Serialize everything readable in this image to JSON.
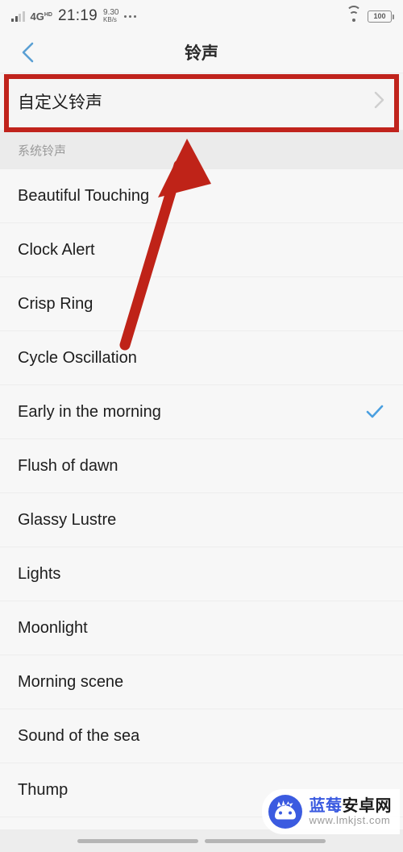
{
  "status_bar": {
    "network_type": "4G",
    "network_type_sup": "HD",
    "time": "21:19",
    "net_speed_value": "9.30",
    "net_speed_unit": "KB/s",
    "more_icon": "three-dots-icon",
    "wifi_icon": "wifi-icon",
    "battery_level": "100"
  },
  "titlebar": {
    "back_icon": "chevron-left-icon",
    "title": "铃声"
  },
  "custom_ringtone": {
    "label": "自定义铃声",
    "chevron_icon": "chevron-right-icon"
  },
  "section": {
    "header": "系统铃声"
  },
  "ringtones": [
    {
      "name": "Beautiful Touching",
      "selected": false
    },
    {
      "name": "Clock Alert",
      "selected": false
    },
    {
      "name": "Crisp Ring",
      "selected": false
    },
    {
      "name": "Cycle Oscillation",
      "selected": false
    },
    {
      "name": "Early in the morning",
      "selected": true
    },
    {
      "name": "Flush of dawn",
      "selected": false
    },
    {
      "name": "Glassy Lustre",
      "selected": false
    },
    {
      "name": "Lights",
      "selected": false
    },
    {
      "name": "Moonlight",
      "selected": false
    },
    {
      "name": "Morning scene",
      "selected": false
    },
    {
      "name": "Sound of the sea",
      "selected": false
    },
    {
      "name": "Thump",
      "selected": false
    }
  ],
  "watermark": {
    "name_blue": "蓝莓",
    "name_dark": "安卓网",
    "url": "www.lmkjst.com"
  },
  "annotations": {
    "highlight_box_color": "#c0231c",
    "arrow_color": "#bf2318"
  },
  "colors": {
    "accent_blue": "#5a9fd4",
    "check_blue": "#4a9fe0",
    "page_bg": "#f7f7f7",
    "section_bg": "#ebebeb"
  }
}
